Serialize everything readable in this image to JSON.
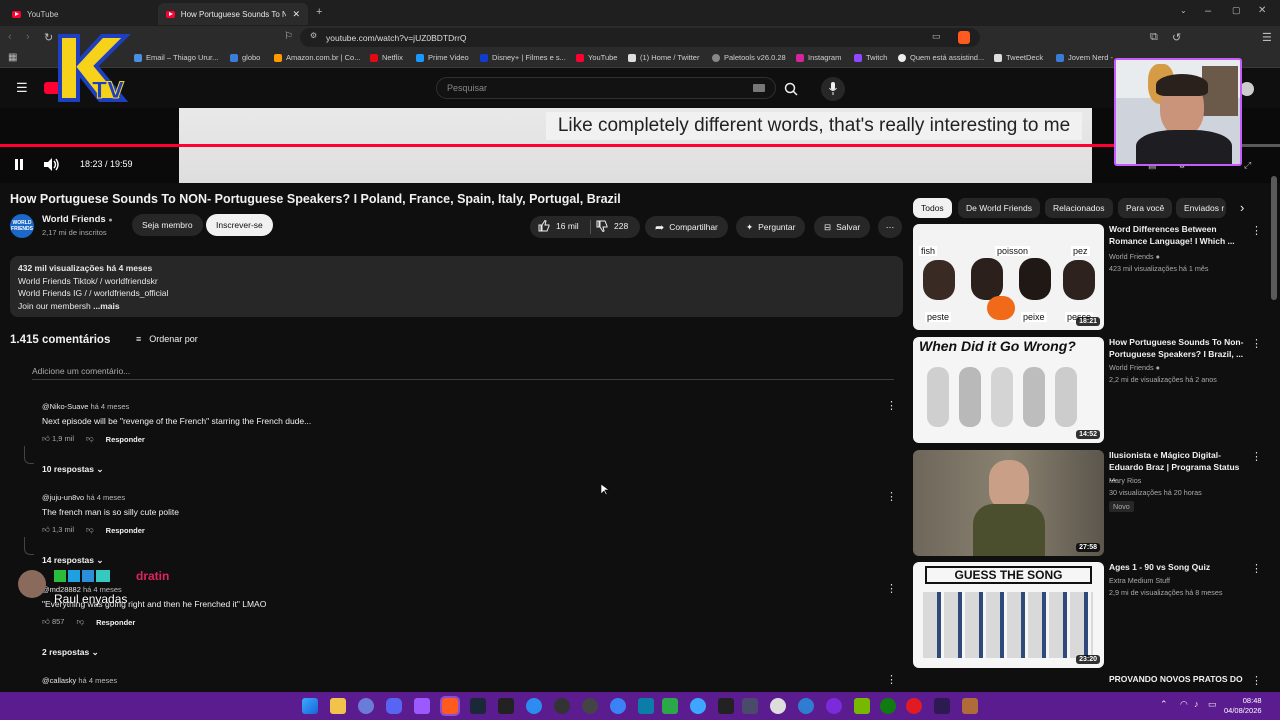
{
  "tabs": [
    "YouTube",
    "How Portuguese Sounds To N"
  ],
  "url": "youtube.com/watch?v=jUZ0BDTDrrQ",
  "bookmarks": [
    "Email – Thiago Urur...",
    "globo",
    "Amazon.com.br | Co...",
    "Netflix",
    "Prime Video",
    "Disney+ | Filmes e s...",
    "YouTube",
    "(1) Home / Twitter",
    "Paletools v26.0.28",
    "Instagram",
    "Twitch",
    "Quem está assistind...",
    "TweetDeck",
    "Jovem Nerd -"
  ],
  "overlay_logo": "KTV",
  "search_placeholder": "Pesquisar",
  "video": {
    "caption": "Like completely different words, that's really interesting to me",
    "time": "18:23 / 19:59",
    "progress": 0.92,
    "title": "How Portuguese Sounds To NON- Portuguese Speakers? I Poland, France, Spain, Italy, Portugal, Brazil"
  },
  "channel": {
    "name": "World Friends",
    "subs": "2,17 mi de inscritos",
    "member": "Seja membro",
    "subscribe": "Inscrever-se"
  },
  "actions": {
    "likes": "16 mil",
    "dislikes": "228",
    "share": "Compartilhar",
    "ask": "Perguntar",
    "save": "Salvar"
  },
  "description": {
    "stats": "432 mil visualizações  há 4 meses",
    "line1": "World Friends Tiktok/      / worldfriendskr",
    "line2": "World Friends IG /      / worldfriends_official",
    "line3": "Join our membersh",
    "more": "...mais"
  },
  "comments": {
    "count": "1.415 comentários",
    "sort": "Ordenar por",
    "add": "Adicione um comentário...",
    "items": [
      {
        "author": "@Niko-Suave",
        "age": "há 4 meses",
        "text": "Next episode will be \"revenge of the French\" starring the French dude...",
        "likes": "1,9 mil",
        "reply": "Responder",
        "replies": "10 respostas"
      },
      {
        "author": "@juju-un8vo",
        "age": "há 4 meses",
        "text": "The french man is so silly cute polite",
        "likes": "1,3 mil",
        "reply": "Responder",
        "replies": "14 respostas"
      },
      {
        "author": "@md28882",
        "age": "há 4 meses",
        "text": "\"Everything was going right and then he Frenched it\" LMAO",
        "likes": "857",
        "reply": "Responder",
        "replies": "2 respostas"
      },
      {
        "author": "@callasky",
        "age": "há 4 meses",
        "text": "",
        "likes": "",
        "reply": "",
        "replies": ""
      }
    ]
  },
  "stream_overlay": {
    "badge_name": "dratin",
    "user": "Raul enyadas"
  },
  "chips": [
    "Todos",
    "De World Friends",
    "Relacionados",
    "Para você",
    "Enviados r"
  ],
  "recommendations": [
    {
      "title": "Word Differences Between Romance Language! I Which ...",
      "channel": "World Friends",
      "meta": "423 mil visualizações  há 1 mês",
      "duration": "18:21",
      "thumb_words": [
        "fish",
        "poisson",
        "pez",
        "peste",
        "peixe",
        "pesce"
      ]
    },
    {
      "title": "How Portuguese Sounds To Non-Portuguese Speakers? I Brazil, ...",
      "channel": "World Friends",
      "meta": "2,2 mi de visualizações  há 2 anos",
      "duration": "14:52",
      "thumb_words": [
        "When Did it Go Wrong?"
      ]
    },
    {
      "title": "Ilusionista e Mágico Digital- Eduardo Braz | Programa Status ...",
      "channel": "Mary Rios",
      "meta": "30 visualizações  há 20 horas",
      "badge": "Novo",
      "duration": "27:58",
      "thumb_words": []
    },
    {
      "title": "Ages 1 - 90 vs Song Quiz",
      "channel": "Extra Medium Stuff",
      "meta": "2,9 mi de visualizações  há 8 meses",
      "duration": "23:20",
      "thumb_words": [
        "GUESS THE SONG"
      ]
    },
    {
      "title": "PROVANDO NOVOS PRATOS DO",
      "channel": "",
      "meta": "",
      "duration": "",
      "thumb_words": []
    }
  ],
  "clock": {
    "time": "08:48",
    "date": "04/08/2026"
  }
}
